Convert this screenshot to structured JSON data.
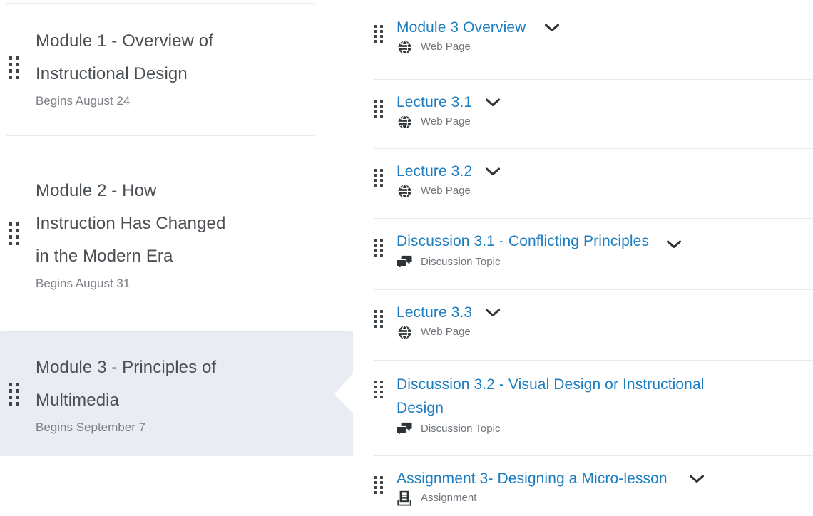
{
  "colors": {
    "link_blue": "#1c7dc0",
    "title_gray": "#4a4f54",
    "muted_gray": "#6f757b",
    "selected_bg": "#e9edf3",
    "divider": "#e7e9ec",
    "icon_dark": "#2d3235"
  },
  "sidebar": {
    "name": "modules-list",
    "items": [
      {
        "title": "Module 1 - Overview of Instructional Design",
        "subtitle": "Begins August 24",
        "selected": false,
        "drag_handle_icon": "drag-handle-icon"
      },
      {
        "title": "Module 2 - How Instruction Has Changed in the Modern Era",
        "subtitle": "Begins August 31",
        "selected": false,
        "drag_handle_icon": "drag-handle-icon"
      },
      {
        "title": "Module 3 - Principles of Multimedia",
        "subtitle": "Begins September 7",
        "selected": true,
        "drag_handle_icon": "drag-handle-icon"
      }
    ]
  },
  "panel": {
    "name": "module-items-list",
    "items": [
      {
        "title": "Module 3 Overview",
        "type_label": "Web Page",
        "type_icon": "globe-icon",
        "drag_handle_icon": "drag-handle-icon",
        "chevron_icon": "chevron-down-icon"
      },
      {
        "title": "Lecture 3.1",
        "type_label": "Web Page",
        "type_icon": "globe-icon",
        "drag_handle_icon": "drag-handle-icon",
        "chevron_icon": "chevron-down-icon"
      },
      {
        "title": "Lecture 3.2",
        "type_label": "Web Page",
        "type_icon": "globe-icon",
        "drag_handle_icon": "drag-handle-icon",
        "chevron_icon": "chevron-down-icon"
      },
      {
        "title": "Discussion 3.1 - Conflicting Principles",
        "type_label": "Discussion Topic",
        "type_icon": "discussion-icon",
        "drag_handle_icon": "drag-handle-icon",
        "chevron_icon": "chevron-down-icon"
      },
      {
        "title": "Lecture 3.3",
        "type_label": "Web Page",
        "type_icon": "globe-icon",
        "drag_handle_icon": "drag-handle-icon",
        "chevron_icon": "chevron-down-icon"
      },
      {
        "title": "Discussion 3.2 - Visual Design or Instructional Design",
        "type_label": "Discussion Topic",
        "type_icon": "discussion-icon",
        "drag_handle_icon": "drag-handle-icon",
        "chevron_icon": "chevron-down-icon"
      },
      {
        "title": "Assignment 3- Designing a Micro-lesson",
        "type_label": "Assignment",
        "type_icon": "assignment-icon",
        "drag_handle_icon": "drag-handle-icon",
        "chevron_icon": "chevron-down-icon"
      }
    ]
  }
}
